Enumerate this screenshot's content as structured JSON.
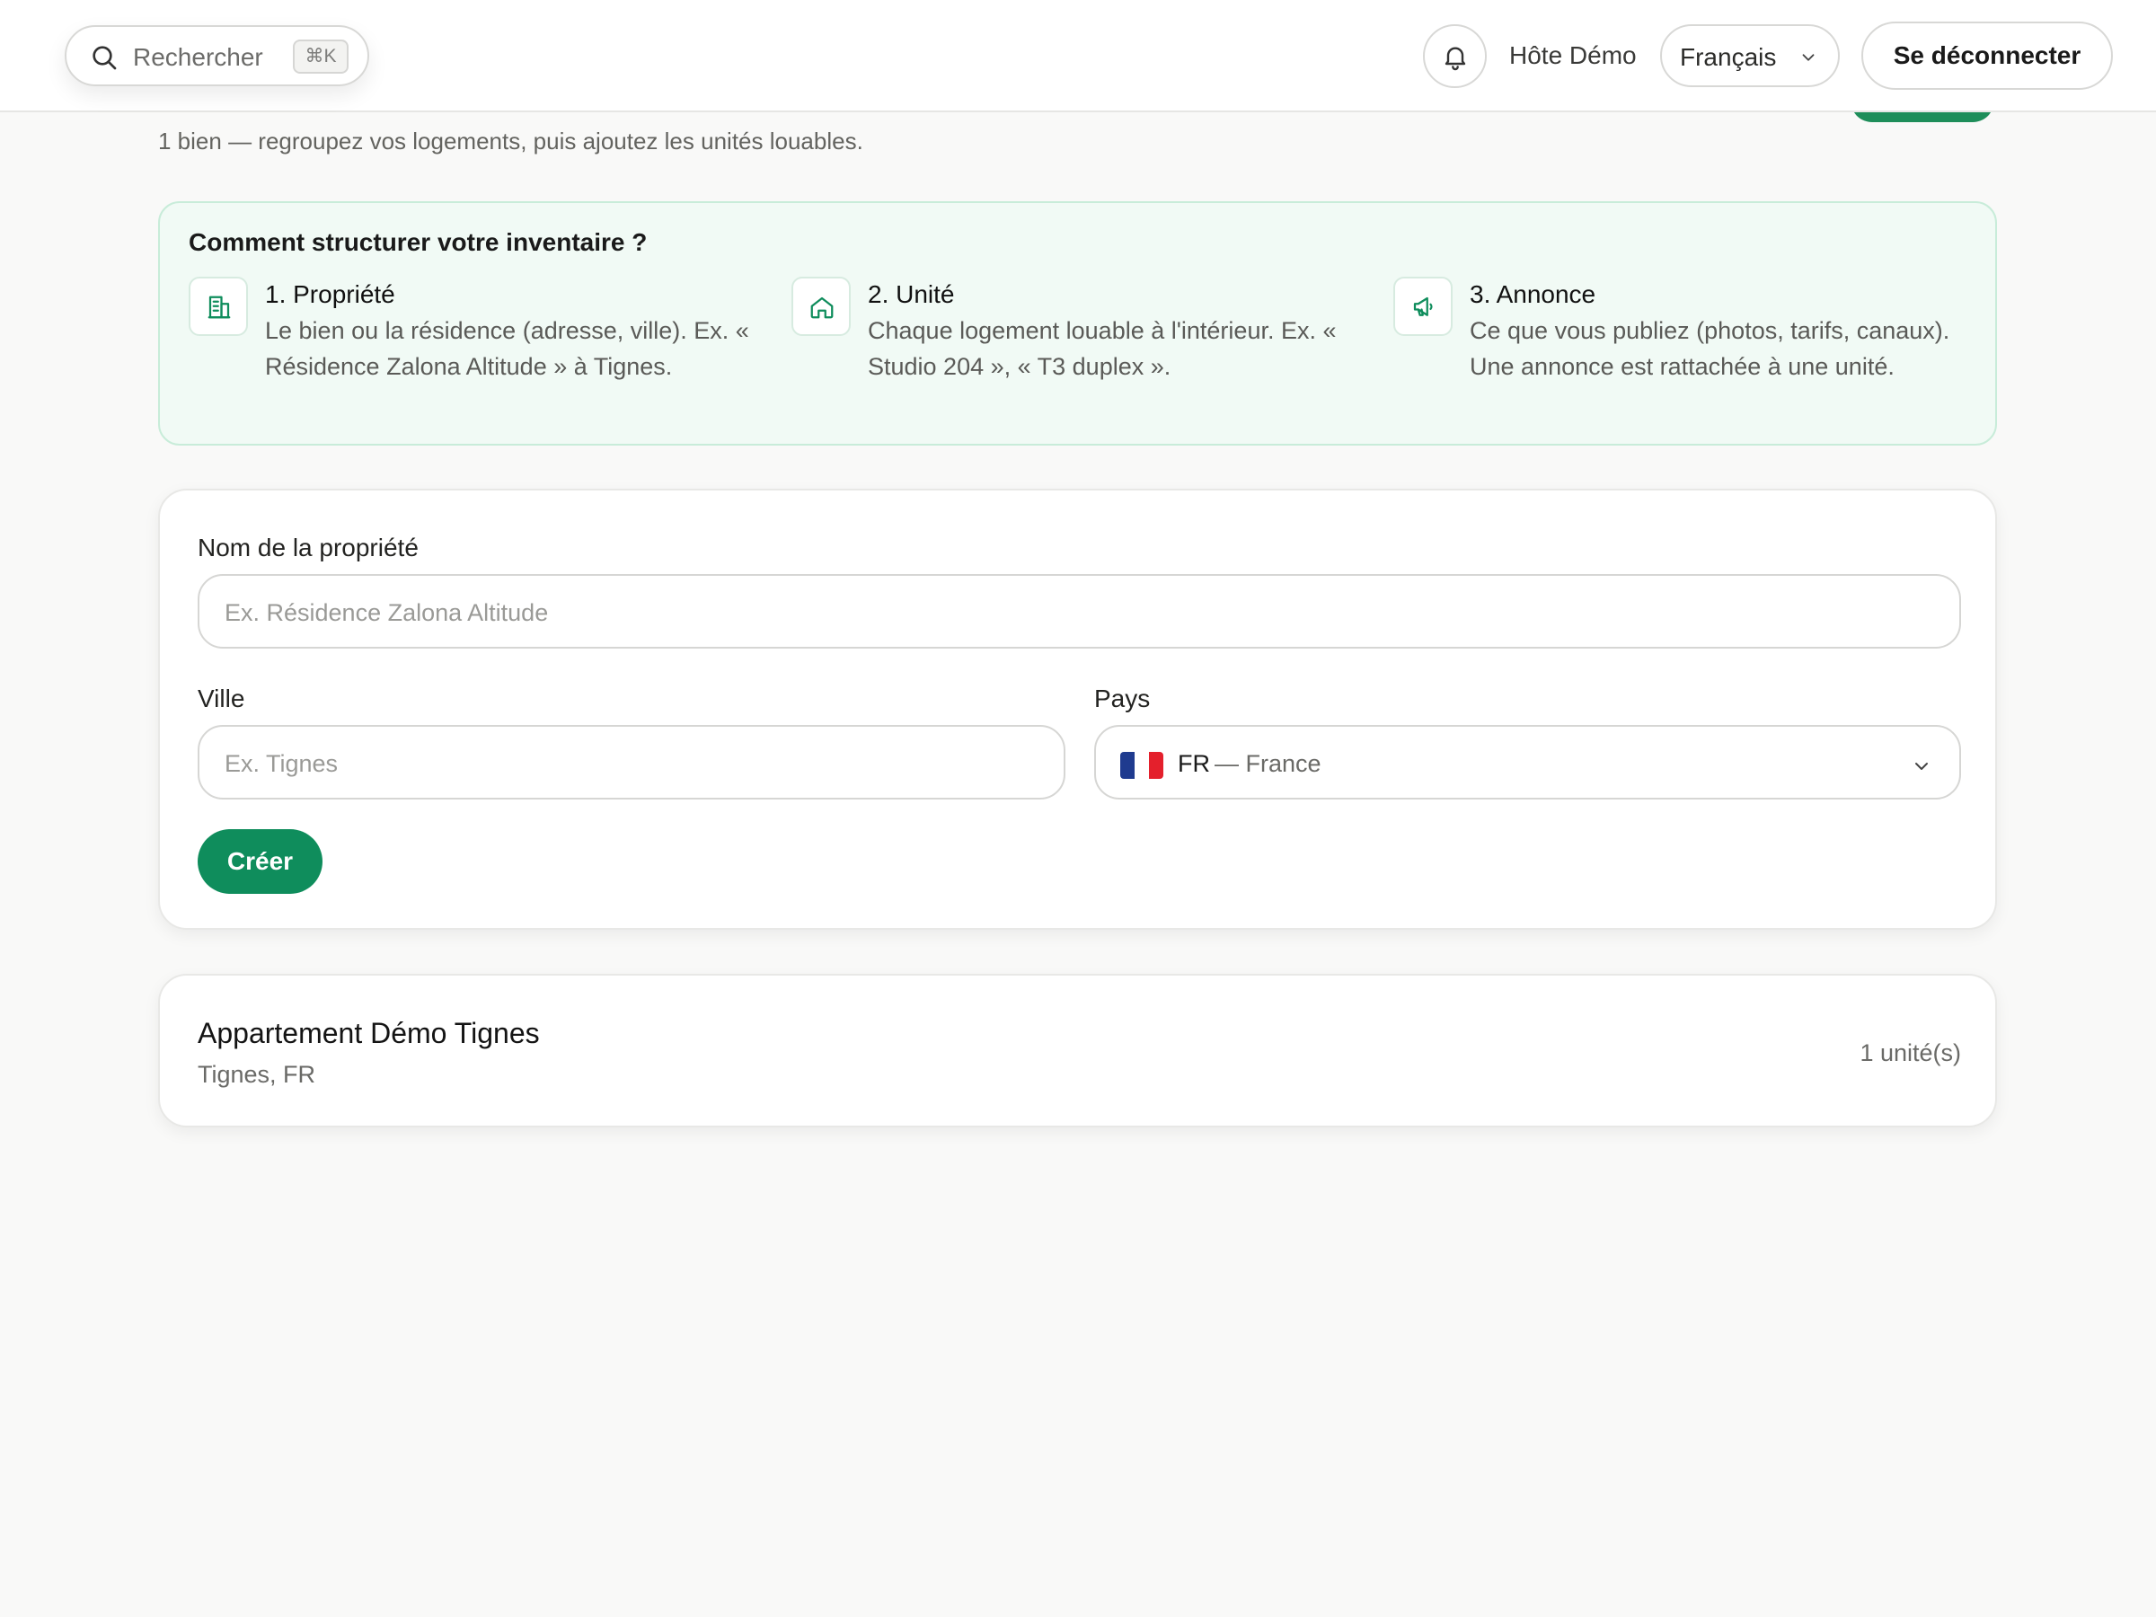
{
  "header": {
    "search_placeholder": "Rechercher",
    "search_shortcut": "⌘K",
    "notifications_icon": "bell-icon",
    "user_name": "Hôte Démo",
    "language": "Français",
    "logout_label": "Se déconnecter"
  },
  "page": {
    "subtitle": "1 bien — regroupez vos logements, puis ajoutez les unités louables."
  },
  "guide": {
    "title": "Comment structurer votre inventaire ?",
    "steps": [
      {
        "icon": "building-icon",
        "title": "1. Propriété",
        "description": "Le bien ou la résidence (adresse, ville). Ex. « Résidence Zalona Altitude » à Tignes."
      },
      {
        "icon": "home-icon",
        "title": "2. Unité",
        "description": "Chaque logement louable à l'intérieur. Ex. « Studio 204 », « T3 duplex »."
      },
      {
        "icon": "megaphone-icon",
        "title": "3. Annonce",
        "description": "Ce que vous publiez (photos, tarifs, canaux). Une annonce est rattachée à une unité."
      }
    ]
  },
  "form": {
    "name_label": "Nom de la propriété",
    "name_placeholder": "Ex. Résidence Zalona Altitude",
    "city_label": "Ville",
    "city_placeholder": "Ex. Tignes",
    "country_label": "Pays",
    "country_code": "FR",
    "country_name": "— France",
    "submit_label": "Créer"
  },
  "properties": [
    {
      "name": "Appartement Démo Tignes",
      "location": "Tignes, FR",
      "units": "1 unité(s)"
    }
  ],
  "colors": {
    "accent": "#0f8d5c",
    "guide_bg": "#f1faf5",
    "guide_border": "#c8ecd9",
    "page_bg": "#f9f9f8"
  }
}
